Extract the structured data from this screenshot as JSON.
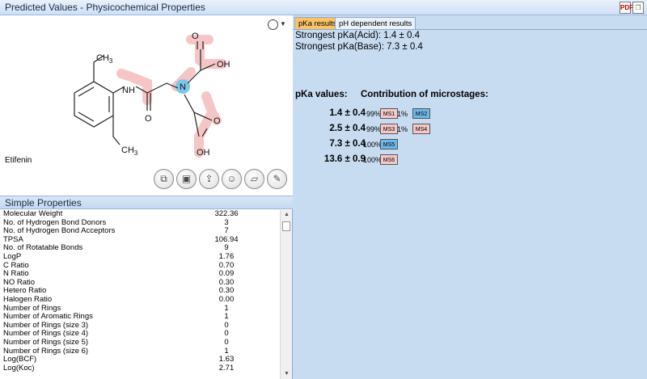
{
  "window": {
    "title": "Predicted Values - Physicochemical Properties",
    "icons": [
      "pdf-export-icon",
      "copy-icon"
    ]
  },
  "molecule": {
    "name": "Etifenin",
    "atom_labels": {
      "ch3_top": "CH",
      "ch3_top_sub": "3",
      "nh": "NH",
      "n": "N",
      "oh_top": "OH",
      "o_top": "O",
      "o_mid": "O",
      "o_bottom": "O",
      "oh_bottom": "OH",
      "ch3_bottom": "CH",
      "ch3_bottom_sub": "3"
    },
    "highlight_colors": {
      "acid": "#f6c6c6",
      "base": "#7ec5ea"
    },
    "toolbar_icons": [
      "copy-structure-icon",
      "copy-image-icon",
      "export-icon",
      "smiley-icon",
      "open-icon",
      "edit-icon"
    ]
  },
  "simple_properties": {
    "header": "Simple Properties",
    "rows": [
      {
        "name": "Molecular Weight",
        "value": "322.36"
      },
      {
        "name": "No. of Hydrogen Bond Donors",
        "value": "3"
      },
      {
        "name": "No. of Hydrogen Bond Acceptors",
        "value": "7"
      },
      {
        "name": "TPSA",
        "value": "106.94"
      },
      {
        "name": "No. of Rotatable Bonds",
        "value": "9"
      },
      {
        "name": "LogP",
        "value": "1.76"
      },
      {
        "name": "C Ratio",
        "value": "0.70"
      },
      {
        "name": "N Ratio",
        "value": "0.09"
      },
      {
        "name": "NO Ratio",
        "value": "0.30"
      },
      {
        "name": "Hetero Ratio",
        "value": "0.30"
      },
      {
        "name": "Halogen Ratio",
        "value": "0.00"
      },
      {
        "name": "Number of Rings",
        "value": "1"
      },
      {
        "name": "Number of Aromatic Rings",
        "value": "1"
      },
      {
        "name": "Number of Rings (size 3)",
        "value": "0"
      },
      {
        "name": "Number of Rings (size 4)",
        "value": "0"
      },
      {
        "name": "Number of Rings (size 5)",
        "value": "0"
      },
      {
        "name": "Number of Rings (size 6)",
        "value": "1"
      },
      {
        "name": "Log(BCF)",
        "value": "1.63"
      },
      {
        "name": "Log(Koc)",
        "value": "2.71"
      }
    ]
  },
  "tabs": [
    {
      "label": "pKa results",
      "active": true
    },
    {
      "label": "pH dependent results",
      "active": false
    }
  ],
  "pka": {
    "strongest_acid": "Strongest pKa(Acid): 1.4 ± 0.4",
    "strongest_base": "Strongest pKa(Base): 7.3 ± 0.4",
    "values_header": "pKa values:",
    "contrib_header": "Contribution of microstages:",
    "rows": [
      {
        "value": "1.4 ± 0.4",
        "stages": [
          {
            "pct": "99%",
            "ms": "MS1",
            "kind": "acid"
          },
          {
            "pct": "1%",
            "ms": "MS2",
            "kind": "base"
          }
        ]
      },
      {
        "value": "2.5 ± 0.4",
        "stages": [
          {
            "pct": "99%",
            "ms": "MS3",
            "kind": "acid"
          },
          {
            "pct": "1%",
            "ms": "MS4",
            "kind": "acid"
          }
        ]
      },
      {
        "value": "7.3 ± 0.4",
        "stages": [
          {
            "pct": "100%",
            "ms": "MS5",
            "kind": "base"
          }
        ]
      },
      {
        "value": "13.6 ± 0.9",
        "stages": [
          {
            "pct": "100%",
            "ms": "MS6",
            "kind": "acid"
          }
        ]
      }
    ]
  }
}
